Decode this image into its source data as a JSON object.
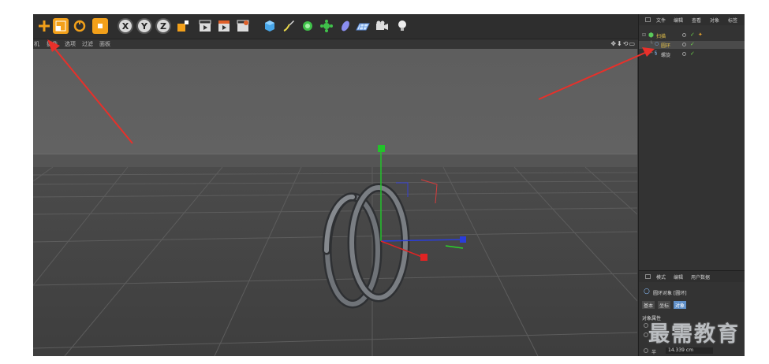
{
  "toolbar": {
    "tools": [
      {
        "name": "move-tool-icon"
      },
      {
        "name": "scale-tool-icon"
      },
      {
        "name": "rotate-tool-icon"
      },
      {
        "name": "object-mode-icon"
      },
      {
        "name": "x-axis-lock",
        "label": "X"
      },
      {
        "name": "y-axis-lock",
        "label": "Y"
      },
      {
        "name": "z-axis-lock",
        "label": "Z"
      },
      {
        "name": "coordinate-system-icon"
      },
      {
        "name": "render-view-icon"
      },
      {
        "name": "render-picture-viewer-icon"
      },
      {
        "name": "render-settings-icon"
      },
      {
        "name": "cube-icon"
      },
      {
        "name": "pen-spline-icon"
      },
      {
        "name": "subdivision-icon"
      },
      {
        "name": "array-cloner-icon"
      },
      {
        "name": "deformer-icon"
      },
      {
        "name": "floor-plane-icon"
      },
      {
        "name": "camera-icon"
      },
      {
        "name": "light-icon"
      }
    ]
  },
  "viewport_menu": {
    "items": [
      "机",
      "摄像",
      "选项",
      "过滤",
      "面板"
    ]
  },
  "object_manager": {
    "menu": [
      "文件",
      "编辑",
      "查看",
      "对象",
      "标签"
    ],
    "objects": [
      {
        "name": "扫描",
        "color": "#e7c34a"
      },
      {
        "name": "圆环",
        "color": "#e7c34a"
      },
      {
        "name": "螺旋",
        "color": "#d0d0d0"
      }
    ]
  },
  "attribute_manager": {
    "menu": [
      "模式",
      "编辑",
      "用户数据"
    ],
    "object_title": "圆环对象 [圆环]",
    "tabs": [
      "基本",
      "坐标",
      "对象"
    ],
    "active_tab": "对象",
    "section": "对象属性",
    "fields": [
      {
        "label": "半径",
        "value": "14.339 cm"
      }
    ]
  },
  "watermark": "最需教育",
  "colors": {
    "annotation_arrow": "#e8302a",
    "active_tab": "#5f8fc8",
    "axis_y": "#22c32a",
    "axis_x": "#e02424",
    "axis_z": "#2a3ddb"
  }
}
